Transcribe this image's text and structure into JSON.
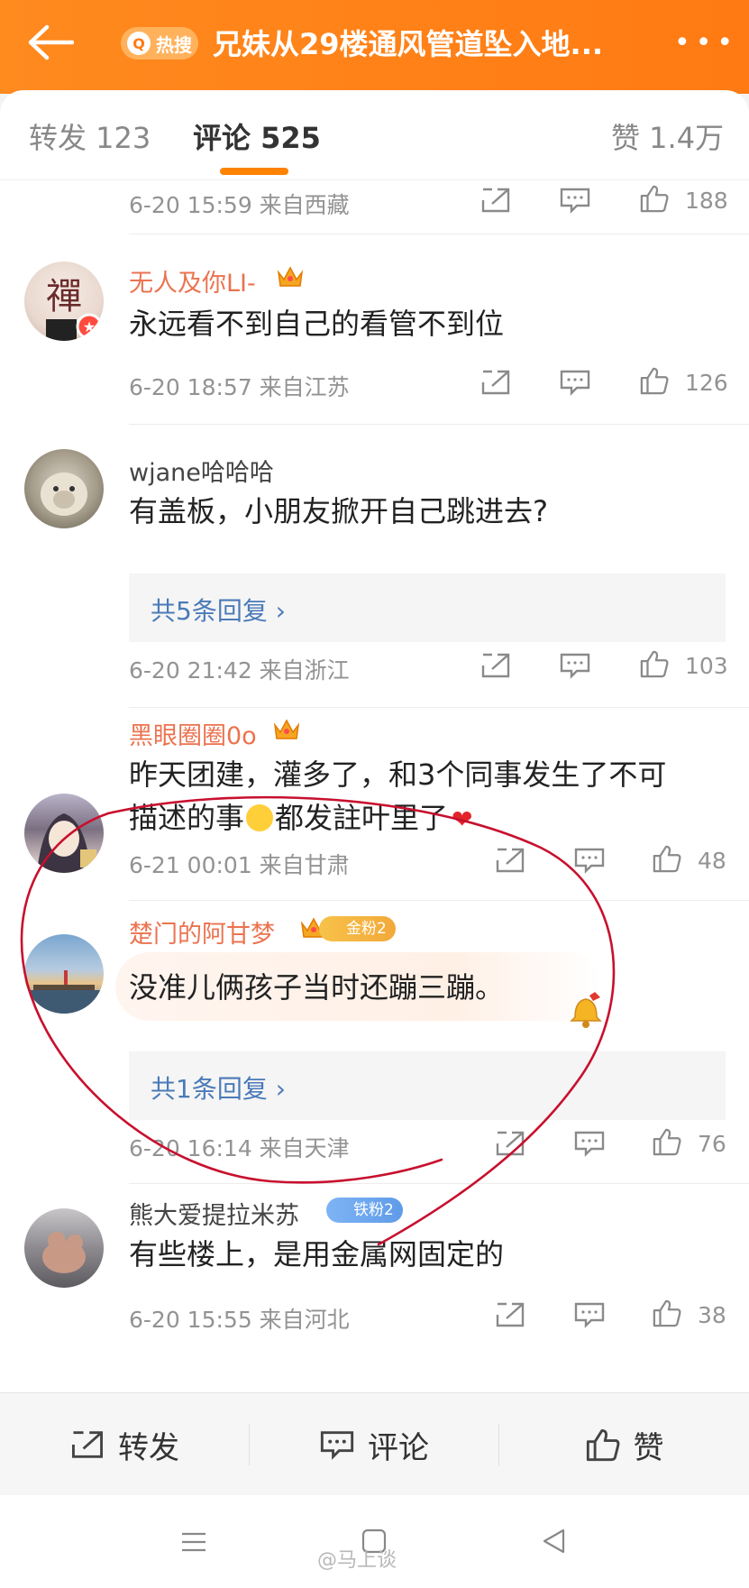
{
  "header": {
    "hot_badge": "热搜",
    "title": "兄妹从29楼通风管道坠入地...",
    "more": "•••"
  },
  "tabs": [
    {
      "label": "转发 123"
    },
    {
      "label": "评论 525"
    },
    {
      "label": "赞 1.4万"
    }
  ],
  "comments": [
    {
      "meta": "6-20 15:59  来自西藏",
      "likes": "188"
    },
    {
      "name": "无人及你LI-",
      "text": "永远看不到自己的看管不到位",
      "meta": "6-20 18:57  来自江苏",
      "likes": "126"
    },
    {
      "name": "wjane哈哈哈",
      "text": "有盖板，小朋友掀开自己跳进去?",
      "replies": "共5条回复 ›",
      "meta": "6-20 21:42  来自浙江",
      "likes": "103"
    },
    {
      "name": "黑眼圈圈0o",
      "text_line1": "昨天团建，灌多了，和3个同事发生了不可",
      "text_line2": "描述的事",
      "text_line2_rest": "都发註叶里了",
      "meta": "6-21 00:01  来自甘肃",
      "likes": "48"
    },
    {
      "name": "楚门的阿甘梦",
      "badge": "金粉2",
      "text": "没准儿俩孩子当时还蹦三蹦。",
      "replies": "共1条回复 ›",
      "meta": "6-20 16:14  来自天津",
      "likes": "76"
    },
    {
      "name": "熊大爱提拉米苏",
      "badge": "铁粉2",
      "text": "有些楼上，是用金属网固定的",
      "meta": "6-20 15:55  来自河北",
      "likes": "38"
    }
  ],
  "actionbar": {
    "repost": "转发",
    "comment": "评论",
    "like": "赞"
  },
  "watermark": "@马上谈",
  "colors": {
    "brand": "#ff8200",
    "username_orange": "#eb7350",
    "link_blue": "#4b7ab8",
    "annotation_red": "#c8102e"
  }
}
